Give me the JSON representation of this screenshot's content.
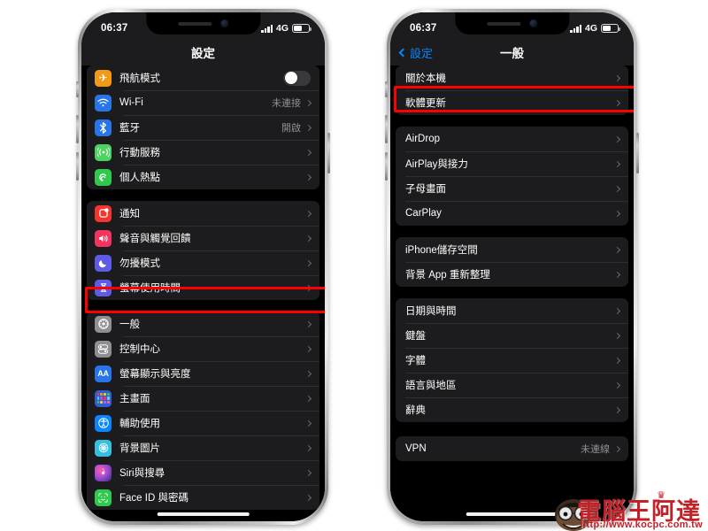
{
  "watermark": {
    "brand": "電腦王阿達",
    "url": "http://www.kocpc.com.tw",
    "crown": "♛",
    "color": "#c42027"
  },
  "phones": [
    {
      "id": "left",
      "status_bar": {
        "time": "06:37",
        "network": "4G",
        "signal_bars": 4,
        "battery_level": 55
      },
      "nav": {
        "title": "設定",
        "back_label": null
      },
      "highlight": {
        "target": "一般",
        "color": "#ff0000"
      },
      "groups": [
        {
          "rows": [
            {
              "label": "飛航模式",
              "icon": "airplane-icon",
              "icon_bg": "#f09a18",
              "glyph": "✈",
              "control": "toggle",
              "toggle_on": false
            },
            {
              "label": "Wi-Fi",
              "icon": "wifi-icon",
              "icon_bg": "#2775e8",
              "glyph": "◗",
              "value": "未連接",
              "control": "chevron"
            },
            {
              "label": "藍牙",
              "icon": "bluetooth-icon",
              "icon_bg": "#2775e8",
              "glyph": "✦",
              "value": "開啟",
              "control": "chevron"
            },
            {
              "label": "行動服務",
              "icon": "cellular-icon",
              "icon_bg": "#4cd35f",
              "glyph": "((●))",
              "control": "chevron"
            },
            {
              "label": "個人熱點",
              "icon": "hotspot-icon",
              "icon_bg": "#30c94e",
              "glyph": "◉",
              "control": "chevron"
            }
          ]
        },
        {
          "rows": [
            {
              "label": "通知",
              "icon": "notifications-icon",
              "icon_bg": "#f2352e",
              "glyph": "▣",
              "control": "chevron"
            },
            {
              "label": "聲音與觸覺回饋",
              "icon": "sounds-icon",
              "icon_bg": "#f2355e",
              "glyph": "◀))",
              "control": "chevron"
            },
            {
              "label": "勿擾模式",
              "icon": "do-not-disturb-icon",
              "icon_bg": "#5e5ce6",
              "glyph": "☾",
              "control": "chevron"
            },
            {
              "label": "螢幕使用時間",
              "icon": "screen-time-icon",
              "icon_bg": "#5e5ce6",
              "glyph": "⧗",
              "control": "chevron"
            }
          ]
        },
        {
          "rows": [
            {
              "label": "一般",
              "icon": "general-gear-icon",
              "icon_bg": "#8e8e93",
              "glyph": "⚙",
              "control": "chevron",
              "highlighted": true
            },
            {
              "label": "控制中心",
              "icon": "control-center-icon",
              "icon_bg": "#8e8e93",
              "glyph": "◎",
              "control": "chevron"
            },
            {
              "label": "螢幕顯示與亮度",
              "icon": "display-brightness-icon",
              "icon_bg": "#2775e8",
              "glyph": "AA",
              "control": "chevron"
            },
            {
              "label": "主畫面",
              "icon": "home-screen-icon",
              "icon_bg": "#2f5fd8",
              "glyph": "▦",
              "control": "chevron"
            },
            {
              "label": "輔助使用",
              "icon": "accessibility-icon",
              "icon_bg": "#0a84ff",
              "glyph": "☉",
              "control": "chevron"
            },
            {
              "label": "背景圖片",
              "icon": "wallpaper-icon",
              "icon_bg": "#35c0e0",
              "glyph": "❋",
              "control": "chevron"
            },
            {
              "label": "Siri與搜尋",
              "icon": "siri-icon",
              "icon_bg": "#6b3fa0",
              "glyph": "✺",
              "control": "chevron"
            },
            {
              "label": "Face ID 與密碼",
              "icon": "face-id-icon",
              "icon_bg": "#30c94e",
              "glyph": "☺",
              "control": "chevron"
            }
          ]
        }
      ]
    },
    {
      "id": "right",
      "status_bar": {
        "time": "06:37",
        "network": "4G",
        "signal_bars": 4,
        "battery_level": 55
      },
      "nav": {
        "title": "一般",
        "back_label": "設定"
      },
      "highlight": {
        "target": "關於本機",
        "color": "#ff0000"
      },
      "groups": [
        {
          "rows": [
            {
              "label": "關於本機",
              "control": "chevron",
              "highlighted": true
            },
            {
              "label": "軟體更新",
              "control": "chevron"
            }
          ]
        },
        {
          "rows": [
            {
              "label": "AirDrop",
              "control": "chevron"
            },
            {
              "label": "AirPlay與接力",
              "control": "chevron"
            },
            {
              "label": "子母畫面",
              "control": "chevron"
            },
            {
              "label": "CarPlay",
              "control": "chevron"
            }
          ]
        },
        {
          "rows": [
            {
              "label": "iPhone儲存空間",
              "control": "chevron"
            },
            {
              "label": "背景 App 重新整理",
              "control": "chevron"
            }
          ]
        },
        {
          "rows": [
            {
              "label": "日期與時間",
              "control": "chevron"
            },
            {
              "label": "鍵盤",
              "control": "chevron"
            },
            {
              "label": "字體",
              "control": "chevron"
            },
            {
              "label": "語言與地區",
              "control": "chevron"
            },
            {
              "label": "辭典",
              "control": "chevron"
            }
          ]
        },
        {
          "rows": [
            {
              "label": "VPN",
              "value": "未連線",
              "control": "chevron"
            }
          ]
        }
      ]
    }
  ]
}
